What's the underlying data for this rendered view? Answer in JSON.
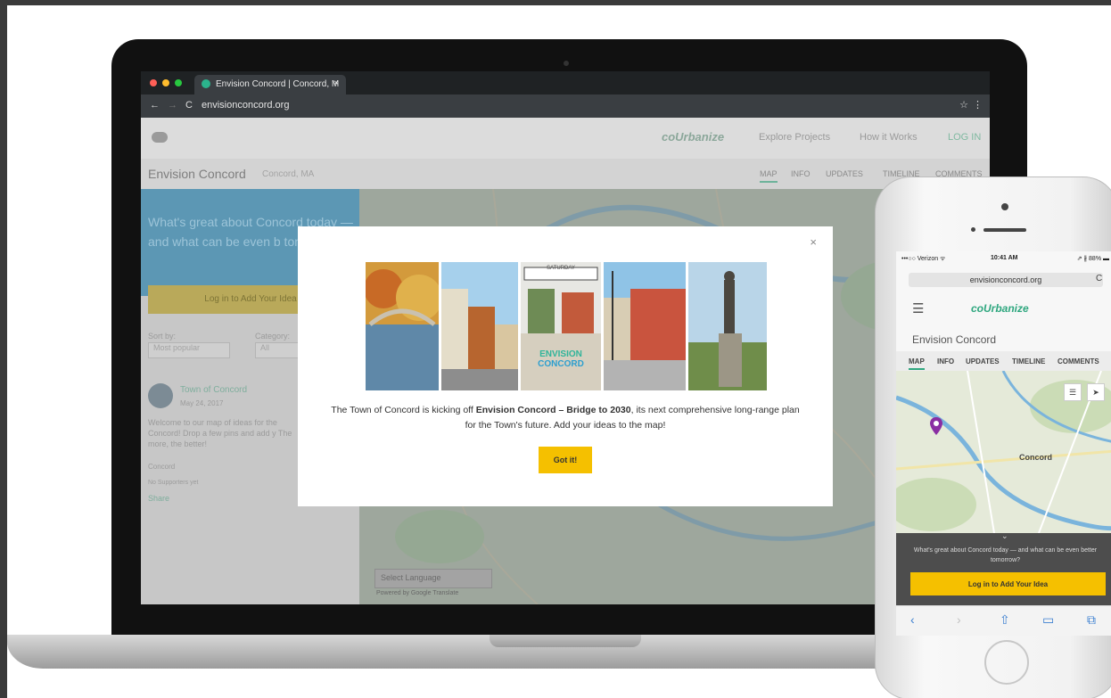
{
  "browser": {
    "tab_title": "Envision Concord | Concord, M",
    "tab_close": "×",
    "url": "envisionconcord.org",
    "back": "←",
    "forward": "→",
    "reload": "C",
    "bookmark": "☆",
    "menu": "⋮"
  },
  "site_header": {
    "logo": "coUrbanize",
    "nav": [
      "Explore Projects",
      "How it Works",
      "LOG IN"
    ]
  },
  "project": {
    "name": "Envision Concord",
    "location": "Concord, MA",
    "tabs": [
      "MAP",
      "INFO",
      "UPDATES",
      "TIMELINE",
      "COMMENTS"
    ]
  },
  "sidebar": {
    "headline": "What's great about Concord today — and what can be even b tomorrow?",
    "cta": "Log in to Add Your Idea",
    "sort_label": "Sort by:",
    "sort_value": "Most popular",
    "category_label": "Category:",
    "category_value": "All",
    "post_author": "Town of Concord",
    "post_date": "May 24, 2017",
    "post_body": "Welcome to our map of ideas for the Concord! Drop a few pins and add y The more, the better!",
    "post_meta_1": "Concord",
    "post_meta_2": "No Supporters yet",
    "post_share": "Share"
  },
  "map": {
    "language_select": "Select Language",
    "powered_by": "Powered by Google Translate"
  },
  "modal": {
    "close": "×",
    "photo_sign": "SATURDAY",
    "logo_line1": "ENVISION",
    "logo_line2": "CONCORD",
    "text_before": "The Town of Concord is kicking off ",
    "text_bold": "Envision Concord – Bridge to 2030",
    "text_after": ", its next comprehensive long-range plan for the Town's future. Add your ideas to the map!",
    "button": "Got it!"
  },
  "phone": {
    "carrier": "•••○○ Verizon ᯤ",
    "time": "10:41 AM",
    "battery": "⇗ ∦ 88% ▬",
    "url": "envisionconcord.org",
    "reload": "C",
    "menu_icon": "☰",
    "logo": "coUrbanize",
    "project_title": "Envision Concord",
    "tabs": [
      "MAP",
      "INFO",
      "UPDATES",
      "TIMELINE",
      "COMMENTS"
    ],
    "map_label": "Concord",
    "map_list_icon": "☰",
    "map_locate_icon": "➤",
    "chevron": "⌄",
    "prompt": "What's great about Concord today — and what can be even better tomorrow?",
    "cta": "Log in to Add Your Idea",
    "toolbar": [
      "‹",
      "›",
      "⇧",
      "▭",
      "⧉"
    ]
  },
  "colors": {
    "accent_yellow": "#f5c000",
    "brand_green": "#2fa77f",
    "hero_blue": "#5c97b4"
  }
}
